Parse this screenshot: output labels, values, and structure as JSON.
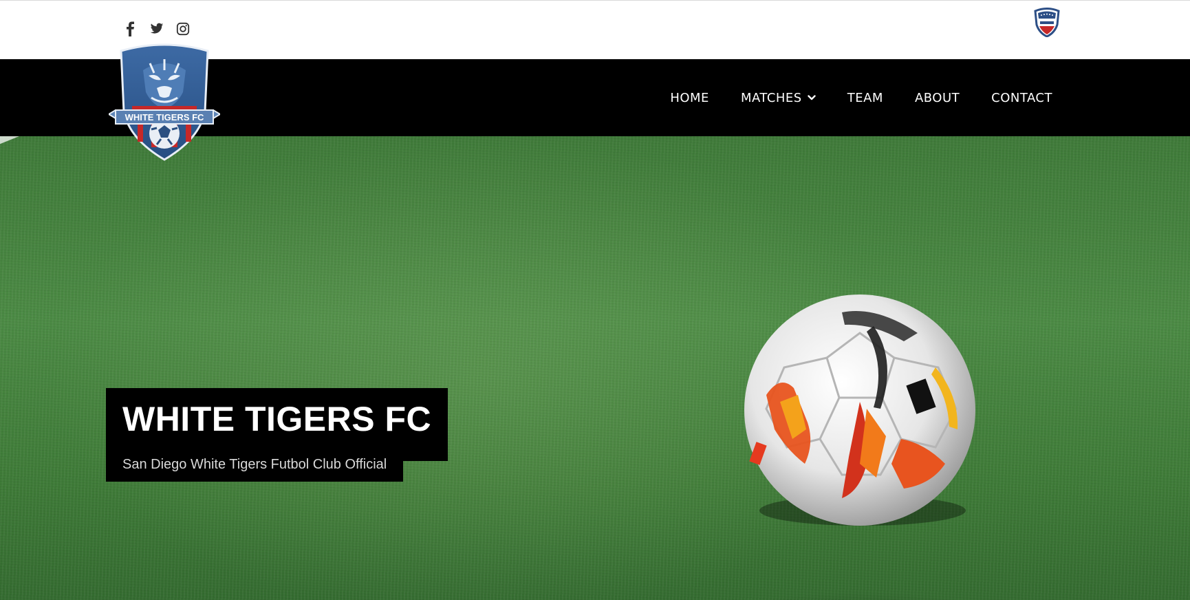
{
  "header": {
    "social_icons": [
      "facebook-icon",
      "twitter-icon",
      "instagram-icon"
    ],
    "partner_logo": "upsl-logo"
  },
  "logo": {
    "text": "WHITE TIGERS FC"
  },
  "nav": {
    "items": [
      {
        "label": "HOME"
      },
      {
        "label": "MATCHES",
        "has_dropdown": true
      },
      {
        "label": "TEAM"
      },
      {
        "label": "ABOUT"
      },
      {
        "label": "CONTACT"
      }
    ]
  },
  "hero": {
    "title": "WHITE TIGERS FC",
    "subtitle": "San Diego White Tigers Futbol Club Official"
  },
  "colors": {
    "navbar": "#000000",
    "nav_text": "#ffffff",
    "crest_blue": "#2f5f9a",
    "crest_red": "#c62828",
    "turf_green": "#4b8a44"
  }
}
